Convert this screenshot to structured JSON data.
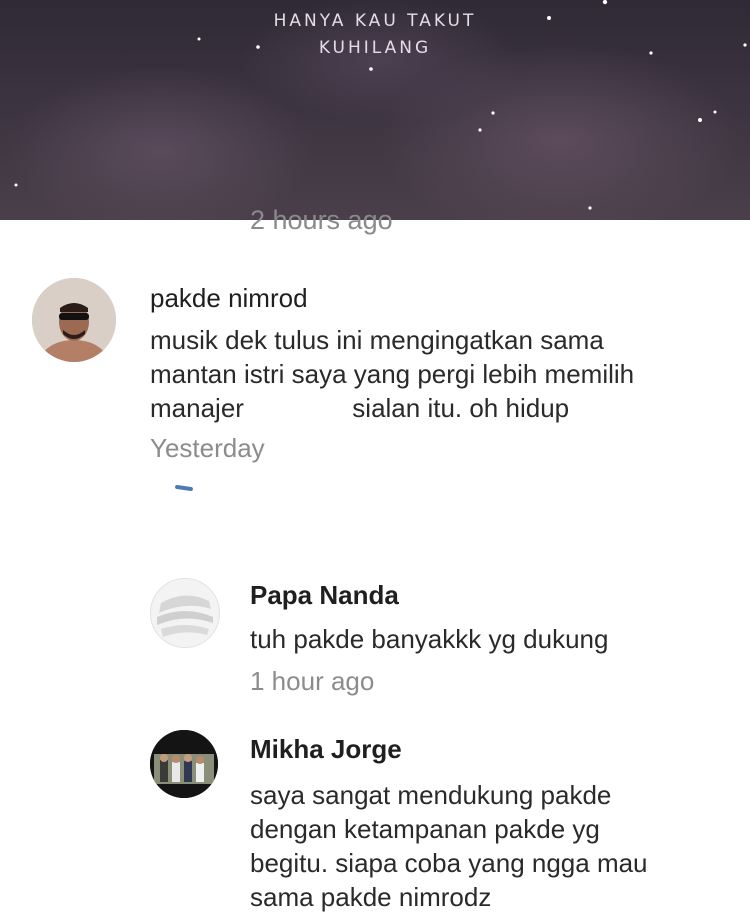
{
  "banner": {
    "lyric_line_1": "HANYA KAU TAKUT",
    "lyric_line_2": "KUHILANG"
  },
  "previous_comment": {
    "timestamp": "2 hours ago"
  },
  "comment": {
    "author": "pakde nimrod",
    "text_lines": [
      "musik dek tulus ini mengingatkan sama",
      "mantan istri saya yang pergi lebih memilih",
      "manajer               sialan itu. oh hidup"
    ],
    "timestamp": "Yesterday",
    "replies": [
      {
        "author": "Papa Nanda",
        "text_lines": [
          "tuh pakde banyakkk yg dukung"
        ],
        "timestamp": "1 hour ago"
      },
      {
        "author": "Mikha Jorge",
        "text_lines": [
          "saya sangat mendukung pakde",
          "dengan ketampanan pakde yg",
          "begitu. siapa coba yang ngga mau",
          "sama pakde nimrodz"
        ]
      }
    ]
  },
  "colors": {
    "text_primary": "#1f1f1f",
    "text_secondary": "#8c8c8c",
    "background": "#ffffff",
    "accent": "#4a7ab8"
  }
}
